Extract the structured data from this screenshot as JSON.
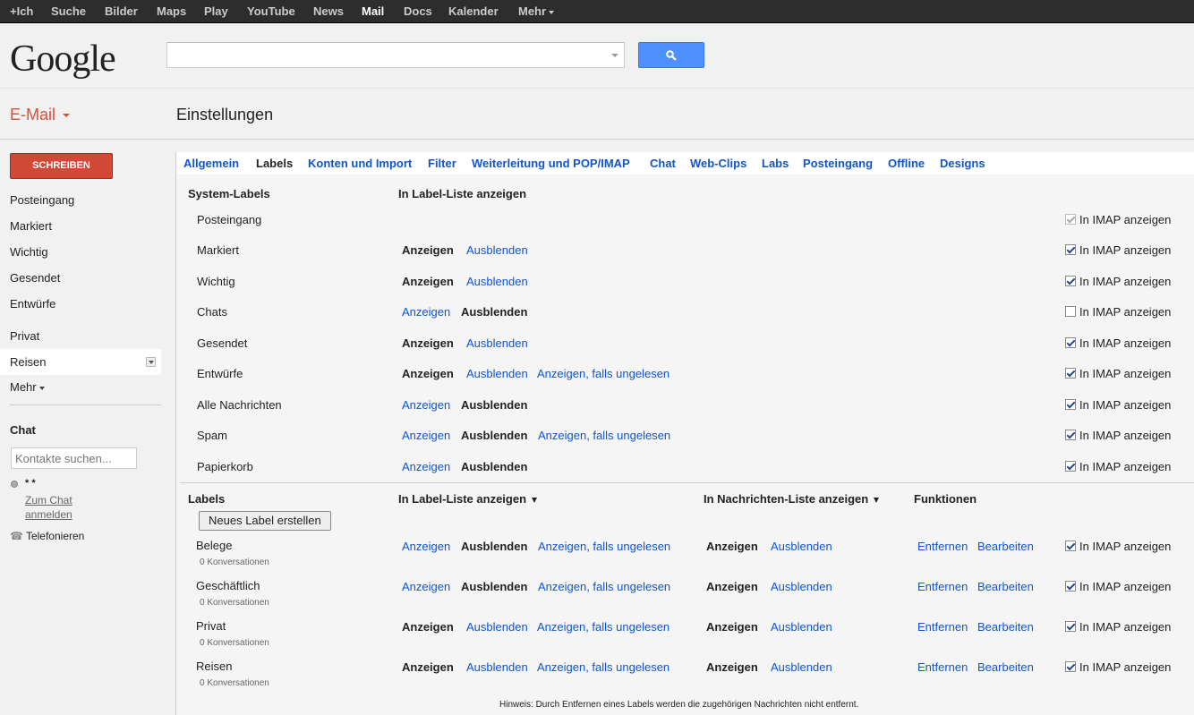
{
  "topbar": {
    "items": [
      "+Ich",
      "Suche",
      "Bilder",
      "Maps",
      "Play",
      "YouTube",
      "News",
      "Mail",
      "Docs",
      "Kalender",
      "Mehr"
    ]
  },
  "header": {
    "logo": "Google",
    "search_value": ""
  },
  "subheader": {
    "app": "E-Mail",
    "title": "Einstellungen"
  },
  "nav": {
    "compose": "SCHREIBEN",
    "items": [
      "Posteingang",
      "Markiert",
      "Wichtig",
      "Gesendet",
      "Entwürfe",
      "Privat",
      "Reisen",
      "Mehr"
    ],
    "chat_title": "Chat",
    "chat_placeholder": "Kontakte suchen...",
    "chat_user": "* *",
    "chat_signin": "Zum Chat anmelden",
    "phone": "Telefonieren"
  },
  "tabs": [
    "Allgemein",
    "Labels",
    "Konten und Import",
    "Filter",
    "Weiterleitung und POP/IMAP",
    "Chat",
    "Web-Clips",
    "Labs",
    "Posteingang",
    "Offline",
    "Designs"
  ],
  "system": {
    "header": "System-Labels",
    "col_list": "In Label-Liste anzeigen",
    "show": "Anzeigen",
    "hide": "Ausblenden",
    "if_unread": "Anzeigen, falls ungelesen",
    "imap": "In IMAP anzeigen",
    "rows": [
      {
        "name": "Posteingang"
      },
      {
        "name": "Markiert"
      },
      {
        "name": "Wichtig"
      },
      {
        "name": "Chats"
      },
      {
        "name": "Gesendet"
      },
      {
        "name": "Entwürfe"
      },
      {
        "name": "Alle Nachrichten"
      },
      {
        "name": "Spam"
      },
      {
        "name": "Papierkorb"
      }
    ]
  },
  "labels": {
    "header": "Labels",
    "col_list": "In Label-Liste anzeigen",
    "col_msgs": "In Nachrichten-Liste anzeigen",
    "col_func": "Funktionen",
    "new_button": "Neues Label erstellen",
    "remove": "Entfernen",
    "edit": "Bearbeiten",
    "rows": [
      {
        "name": "Belege",
        "count": "0 Konversationen"
      },
      {
        "name": "Geschäftlich",
        "count": "0 Konversationen"
      },
      {
        "name": "Privat",
        "count": "0 Konversationen"
      },
      {
        "name": "Reisen",
        "count": "0 Konversationen"
      }
    ]
  },
  "note": "Hinweis: Durch Entfernen eines Labels werden die zugehörigen Nachrichten nicht entfernt."
}
